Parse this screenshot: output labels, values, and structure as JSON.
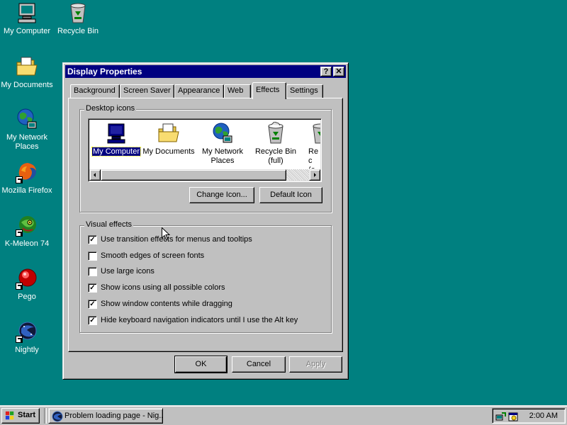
{
  "desktop": {
    "icons": [
      {
        "label": "My Computer",
        "icon": "my-computer-icon"
      },
      {
        "label": "Recycle Bin",
        "icon": "recycle-bin-icon"
      },
      {
        "label": "My Documents",
        "icon": "my-documents-icon"
      },
      {
        "label": "My Network Places",
        "icon": "network-places-icon"
      },
      {
        "label": "Mozilla Firefox",
        "icon": "firefox-icon"
      },
      {
        "label": "K-Meleon 74",
        "icon": "k-meleon-icon"
      },
      {
        "label": "Pego",
        "icon": "pego-icon"
      },
      {
        "label": "Nightly",
        "icon": "nightly-icon"
      }
    ]
  },
  "window": {
    "title": "Display Properties",
    "help_button": "?",
    "close_button": "✕",
    "tabs": [
      {
        "label": "Background"
      },
      {
        "label": "Screen Saver"
      },
      {
        "label": "Appearance"
      },
      {
        "label": "Web"
      },
      {
        "label": "Effects",
        "active": true
      },
      {
        "label": "Settings"
      }
    ],
    "desktop_icons_group": {
      "label": "Desktop icons",
      "items": [
        {
          "label": "My Computer",
          "selected": true
        },
        {
          "label": "My Documents"
        },
        {
          "label": "My Network Places"
        },
        {
          "label": "Recycle Bin (full)"
        },
        {
          "label": "Rec (e"
        }
      ],
      "change_icon_button": "Change Icon...",
      "default_icon_button": "Default Icon"
    },
    "visual_effects_group": {
      "label": "Visual effects",
      "options": [
        {
          "label": "Use transition effects for menus and tooltips",
          "checked": true
        },
        {
          "label": "Smooth edges of screen fonts",
          "checked": false
        },
        {
          "label": "Use large icons",
          "checked": false
        },
        {
          "label": "Show icons using all possible colors",
          "checked": true
        },
        {
          "label": "Show window contents while dragging",
          "checked": true
        },
        {
          "label": "Hide keyboard navigation indicators until I use the Alt key",
          "checked": true
        }
      ]
    },
    "buttons": {
      "ok": "OK",
      "cancel": "Cancel",
      "apply": "Apply"
    }
  },
  "taskbar": {
    "start_label": "Start",
    "tasks": [
      {
        "label": "Problem loading page - Nig..."
      }
    ],
    "clock": "2:00 AM"
  },
  "colors": {
    "desktop": "#008080",
    "titlebar": "#000080",
    "face": "#c0c0c0"
  }
}
